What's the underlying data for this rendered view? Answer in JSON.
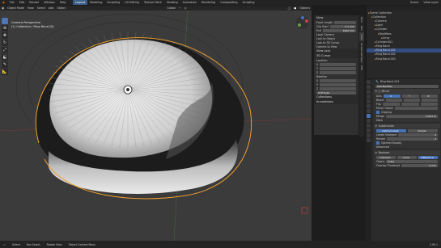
{
  "menubar": {
    "items": [
      "File",
      "Edit",
      "Render",
      "Window",
      "Help"
    ],
    "workspaces": [
      "Layout",
      "Modeling",
      "Sculpting",
      "UV Editing",
      "Texture Paint",
      "Shading",
      "Animation",
      "Rendering",
      "Compositing",
      "Scripting"
    ],
    "scene": "Scene",
    "view_layer": "View Layer"
  },
  "viewport": {
    "mode": "Object Mode",
    "menus": [
      "View",
      "Select",
      "Add",
      "Object"
    ],
    "orientation": "Global",
    "options": "Options",
    "camera_title": "Camera Perspective",
    "collection_label": "(1) Collection | Ring Band (D)"
  },
  "npanel": {
    "view_label": "View",
    "focal_label": "Focal Length",
    "clip_start_label": "Clip Start",
    "clip_start_val": "0.1 mm",
    "clip_end_label": "End",
    "clip_end_val": "1000 mm",
    "local_camera": "Local Camera",
    "lock_label": "Lock to Object",
    "lock_cursor": "Lock to 3D Cursor",
    "camera_view": "Camera to View",
    "view_lock": "View Lock",
    "cursor": "3D Cursor",
    "location": "Location",
    "x": "X",
    "y": "Y",
    "z": "Z",
    "rotation": "Rotation",
    "xyz_euler": "XYZ Euler",
    "collections": "Collections",
    "annotations": "Annotations",
    "tabs": [
      "Item",
      "Tool",
      "View",
      "Screencast Keys",
      "Edit"
    ]
  },
  "outliner": {
    "items": [
      {
        "label": "Scene Collection",
        "indent": 0,
        "selected": false
      },
      {
        "label": "Collection",
        "indent": 1,
        "selected": false
      },
      {
        "label": "Camera",
        "indent": 2,
        "selected": false
      },
      {
        "label": "Light",
        "indent": 2,
        "selected": false
      },
      {
        "label": "Cylinder",
        "indent": 2,
        "selected": false
      },
      {
        "label": "Modifiers",
        "indent": 3,
        "selected": false
      },
      {
        "label": "Array",
        "indent": 4,
        "selected": false
      },
      {
        "label": "Cylinder.001",
        "indent": 2,
        "selected": false
      },
      {
        "label": "Ring Band",
        "indent": 2,
        "selected": false
      },
      {
        "label": "Ring Band.001",
        "indent": 2,
        "selected": true
      },
      {
        "label": "Ring Band.002",
        "indent": 2,
        "selected": false
      },
      {
        "label": "Ring Band.003",
        "indent": 2,
        "selected": false
      }
    ]
  },
  "properties": {
    "object": "Ring Band.001",
    "add_modifier": "Add Modifier",
    "mirror": {
      "name": "Mirror",
      "axis": "Axis",
      "bisect": "Bisect",
      "flip": "Flip",
      "axes": [
        "X",
        "Y",
        "Z"
      ],
      "mirror_object": "Mirror Object",
      "clipping": "Clipping",
      "merge": "Merge",
      "merge_val": "0.001 m"
    },
    "data": "Data",
    "subdivision": {
      "name": "Subdivision",
      "catmull": "Catmull-Clark",
      "simple": "Simple",
      "levels_viewport": "Levels Viewport",
      "levels_viewport_val": "2",
      "render": "Render",
      "render_val": "2",
      "optimal": "Optimal Display"
    },
    "advanced": "Advanced",
    "boolean": {
      "name": "Boolean",
      "intersect": "Intersect",
      "union": "Union",
      "difference": "Difference",
      "object_label": "Object",
      "object_val": "Cube",
      "overlap_label": "Overlap Threshold",
      "overlap_val": "0 mm"
    }
  },
  "statusbar": {
    "select": "Select",
    "box_select": "Box Select",
    "rotate": "Rotate View",
    "context": "Object Context Menu",
    "version": "2.90.1"
  },
  "colors": {
    "accent": "#4772b3",
    "selection_outline": "#f0a030",
    "viewport_bg": "#3b3b3b"
  }
}
